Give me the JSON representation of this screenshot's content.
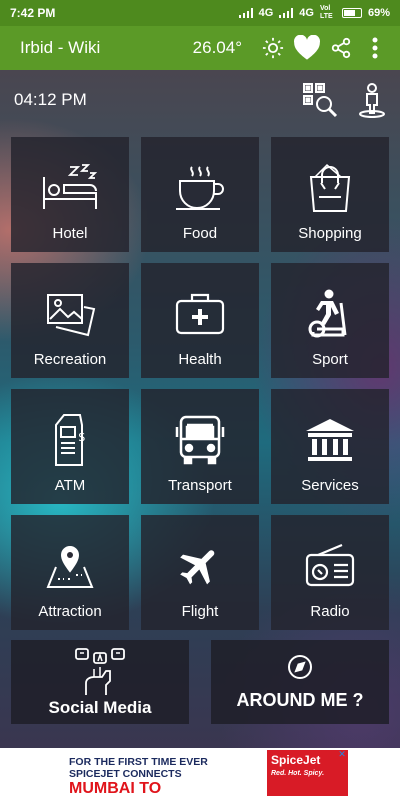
{
  "status_bar": {
    "time": "7:42 PM",
    "network1": "4G",
    "network2": "4G",
    "volte": "Vol LTE",
    "battery": "69%"
  },
  "app_bar": {
    "title": "Irbid - Wiki",
    "temperature": "26.04°"
  },
  "clock": "04:12 PM",
  "tiles": [
    {
      "label": "Hotel",
      "icon": "bed-icon"
    },
    {
      "label": "Food",
      "icon": "coffee-cup-icon"
    },
    {
      "label": "Shopping",
      "icon": "shopping-bag-icon"
    },
    {
      "label": "Recreation",
      "icon": "pictures-icon"
    },
    {
      "label": "Health",
      "icon": "first-aid-kit-icon"
    },
    {
      "label": "Sport",
      "icon": "exercise-bike-icon"
    },
    {
      "label": "ATM",
      "icon": "atm-machine-icon"
    },
    {
      "label": "Transport",
      "icon": "bus-icon"
    },
    {
      "label": "Services",
      "icon": "bank-building-icon"
    },
    {
      "label": "Attraction",
      "icon": "map-pin-icon"
    },
    {
      "label": "Flight",
      "icon": "airplane-icon"
    },
    {
      "label": "Radio",
      "icon": "radio-icon"
    }
  ],
  "social_media": {
    "label": "Social Media",
    "icon": "social-hand-icon"
  },
  "around_me": {
    "label": "AROUND ME ?",
    "icon": "compass-icon"
  },
  "ad": {
    "line1": "FOR THE FIRST TIME EVER",
    "line2": "SPICEJET CONNECTS",
    "line3": "MUMBAI TO",
    "brand": "SpiceJet",
    "tagline": "Red. Hot. Spicy."
  },
  "colors": {
    "app_bar": "#5b9a27",
    "status_bar": "#4e8a1e",
    "tile": "#23232d",
    "ad_red": "#e0141b"
  }
}
